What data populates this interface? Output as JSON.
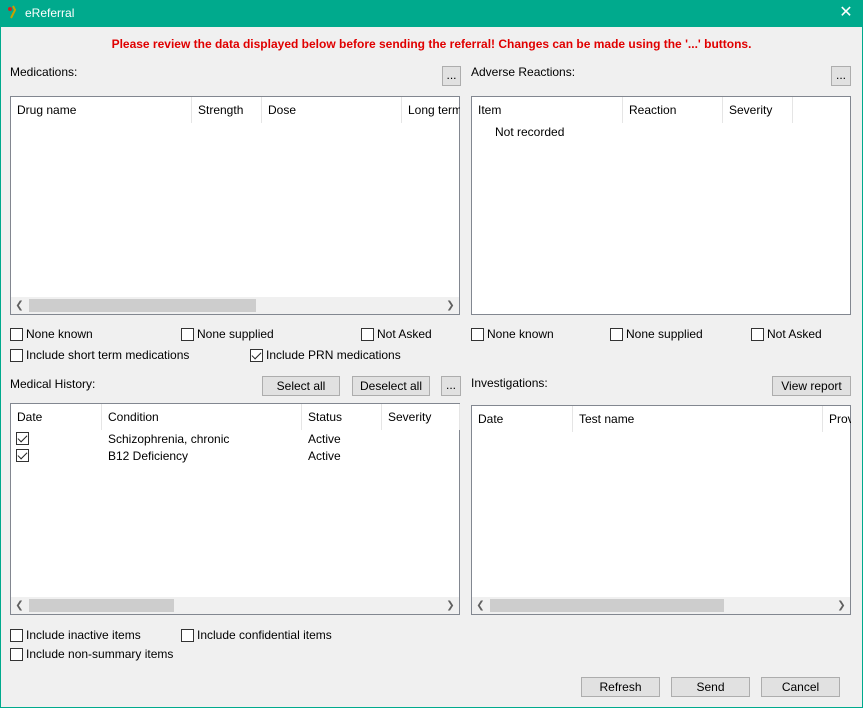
{
  "window": {
    "title": "eReferral",
    "close_glyph": "✕"
  },
  "warning": "Please review the data displayed below before sending the referral!  Changes can be made using the '...' buttons.",
  "medications": {
    "label": "Medications:",
    "edit_button": "...",
    "columns": [
      "Drug name",
      "Strength",
      "Dose",
      "Long term"
    ],
    "checkboxes": {
      "none_known": "None known",
      "none_supplied": "None supplied",
      "not_asked": "Not Asked",
      "include_short_term": "Include short term medications",
      "include_prn": "Include PRN medications"
    },
    "checked": {
      "include_prn": true
    }
  },
  "adverse_reactions": {
    "label": "Adverse Reactions:",
    "edit_button": "...",
    "columns": [
      "Item",
      "Reaction",
      "Severity"
    ],
    "empty_text": "Not recorded",
    "checkboxes": {
      "none_known": "None known",
      "none_supplied": "None supplied",
      "not_asked": "Not Asked"
    }
  },
  "medical_history": {
    "label": "Medical History:",
    "select_all": "Select all",
    "deselect_all": "Deselect all",
    "edit_button": "...",
    "columns": [
      "Date",
      "Condition",
      "Status",
      "Severity"
    ],
    "rows": [
      {
        "checked": true,
        "condition": "Schizophrenia, chronic",
        "status": "Active"
      },
      {
        "checked": true,
        "condition": "B12 Deficiency",
        "status": "Active"
      }
    ],
    "checkboxes": {
      "include_inactive": "Include inactive items",
      "include_confidential": "Include confidential items",
      "include_non_summary": "Include non-summary items"
    }
  },
  "investigations": {
    "label": "Investigations:",
    "view_report": "View report",
    "columns": [
      "Date",
      "Test name",
      "Prov"
    ]
  },
  "footer": {
    "refresh": "Refresh",
    "send": "Send",
    "cancel": "Cancel"
  },
  "colors": {
    "titlebar": "#00aa8d",
    "warning": "#e00000"
  }
}
